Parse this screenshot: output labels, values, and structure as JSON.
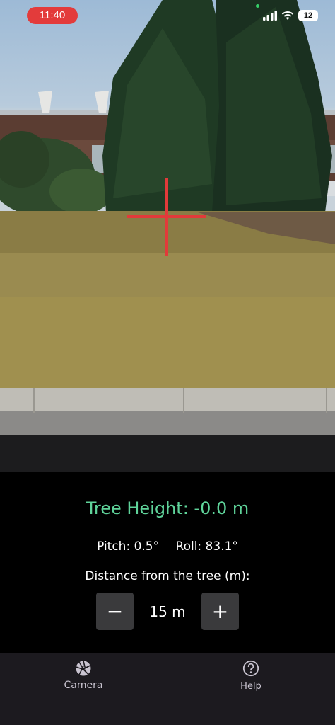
{
  "status_bar": {
    "time": "11:40",
    "battery": "12"
  },
  "measurement": {
    "tree_height_text": "Tree Height: -0.0 m",
    "pitch_text": "Pitch: 0.5°",
    "roll_text": "Roll: 83.1°",
    "distance_label": "Distance from the tree (m):",
    "distance_value": "15 m",
    "decrement_label": "−",
    "increment_label": "+"
  },
  "tab_bar": {
    "items": [
      {
        "label": "Camera",
        "icon": "aperture-icon"
      },
      {
        "label": "Help",
        "icon": "help-circle-icon"
      }
    ]
  },
  "colors": {
    "accent_green": "#5fd39a",
    "crosshair_red": "#e23a3a",
    "time_pill": "#e33b3b"
  }
}
